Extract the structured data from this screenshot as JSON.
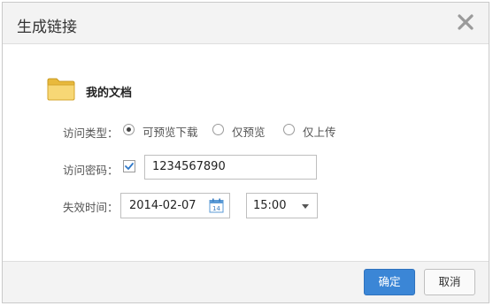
{
  "dialog": {
    "title": "生成链接",
    "doc_name": "我的文档",
    "access_type": {
      "label": "访问类型：",
      "options": [
        {
          "label": "可预览下载",
          "checked": true
        },
        {
          "label": "仅预览",
          "checked": false
        },
        {
          "label": "仅上传",
          "checked": false
        }
      ]
    },
    "password": {
      "label": "访问密码：",
      "enabled": true,
      "value": "1234567890"
    },
    "expiry": {
      "label": "失效时间：",
      "date": "2014-02-07",
      "time": "15:00",
      "calendar_day": "14"
    },
    "buttons": {
      "ok": "确定",
      "cancel": "取消"
    }
  },
  "colors": {
    "primary": "#3b86d6",
    "titlebar_bg": "#f3f3f3",
    "checkmark": "#2f78c8",
    "folder": "#f2c94c"
  },
  "icons": [
    "close-icon",
    "folder-icon",
    "calendar-icon",
    "chevron-down-icon",
    "check-icon"
  ]
}
